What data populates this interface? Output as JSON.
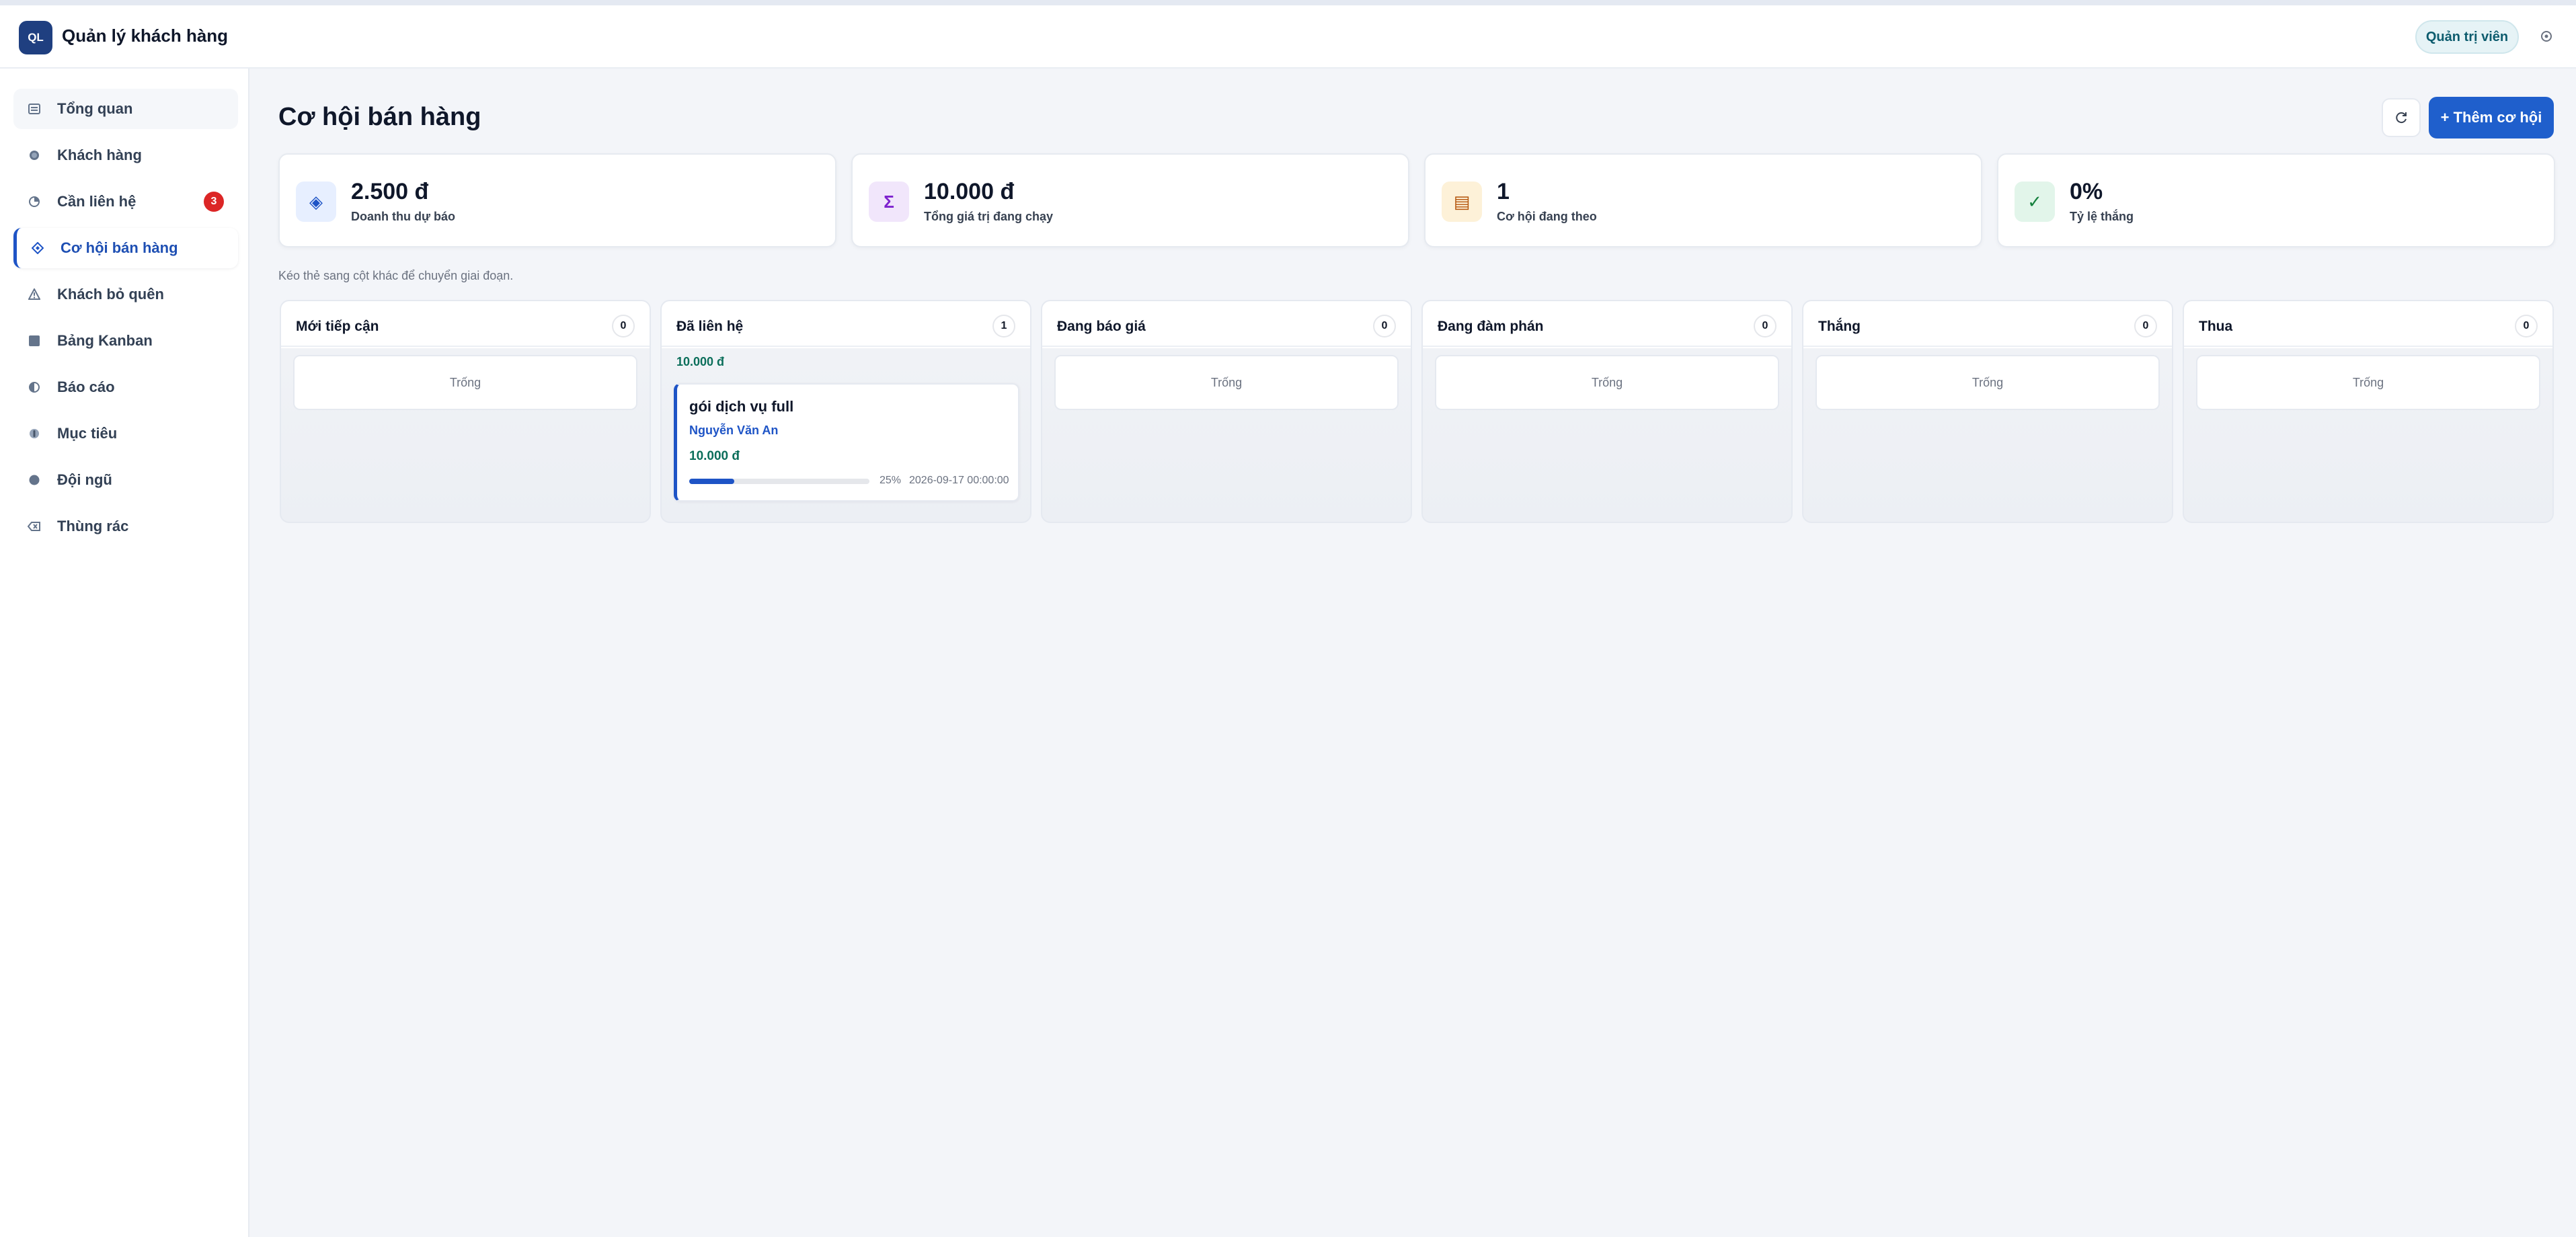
{
  "app": {
    "logo_text": "QL",
    "title": "Quản lý khách hàng",
    "role": "Quản trị viên"
  },
  "sidebar": {
    "items": [
      {
        "label": "Tổng quan",
        "icon": "dashboard-icon"
      },
      {
        "label": "Khách hàng",
        "icon": "customers-icon"
      },
      {
        "label": "Cần liên hệ",
        "icon": "clock-icon",
        "badge": "3"
      },
      {
        "label": "Cơ hội bán hàng",
        "icon": "diamond-icon",
        "active": true
      },
      {
        "label": "Khách bỏ quên",
        "icon": "warning-icon"
      },
      {
        "label": "Bảng Kanban",
        "icon": "kanban-icon"
      },
      {
        "label": "Báo cáo",
        "icon": "report-icon"
      },
      {
        "label": "Mục tiêu",
        "icon": "target-icon"
      },
      {
        "label": "Đội ngũ",
        "icon": "team-icon"
      },
      {
        "label": "Thùng rác",
        "icon": "trash-icon"
      }
    ]
  },
  "main": {
    "title": "Cơ hội bán hàng",
    "add_button": "+ Thêm cơ hội",
    "hint": "Kéo thẻ sang cột khác để chuyển giai đoạn.",
    "stats": [
      {
        "value": "2.500 đ",
        "label": "Doanh thu dự báo",
        "icon": "◈",
        "bg": "#e7efff",
        "color": "#1e54c6"
      },
      {
        "value": "10.000 đ",
        "label": "Tổng giá trị đang chạy",
        "icon": "Σ",
        "bg": "#f1e6fb",
        "color": "#7e22ce"
      },
      {
        "value": "1",
        "label": "Cơ hội đang theo",
        "icon": "▤",
        "bg": "#fdf1d8",
        "color": "#b45309"
      },
      {
        "value": "0%",
        "label": "Tỷ lệ thắng",
        "icon": "✓",
        "bg": "#e2f5ea",
        "color": "#15803d"
      }
    ],
    "columns": [
      {
        "title": "Mới tiếp cận",
        "count": "0",
        "empty": "Trống"
      },
      {
        "title": "Đã liên hệ",
        "count": "1",
        "total": "10.000 đ",
        "card": {
          "title": "gói dịch vụ full",
          "customer": "Nguyễn Văn An",
          "value": "10.000 đ",
          "progress": 0.25,
          "percent": "25%",
          "date": "2026-09-17 00:00:00"
        }
      },
      {
        "title": "Đang báo giá",
        "count": "0",
        "empty": "Trống"
      },
      {
        "title": "Đang đàm phán",
        "count": "0",
        "empty": "Trống"
      },
      {
        "title": "Thắng",
        "count": "0",
        "empty": "Trống"
      },
      {
        "title": "Thua",
        "count": "0",
        "empty": "Trống"
      }
    ]
  }
}
